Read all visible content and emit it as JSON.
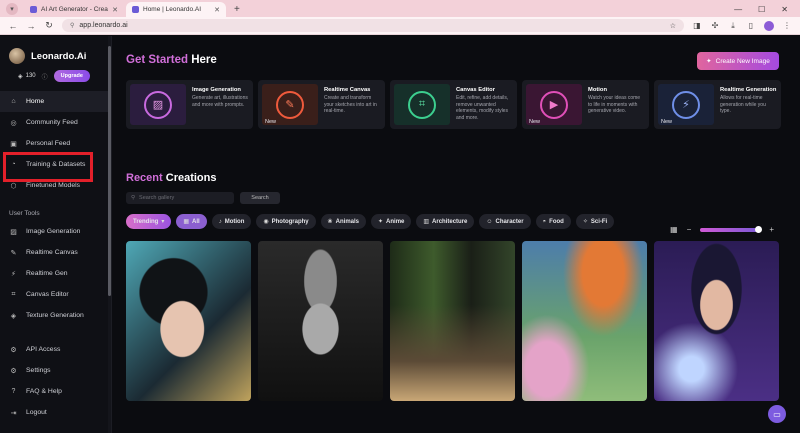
{
  "browser": {
    "tabs": [
      {
        "title": "AI Art Generator - Create Art",
        "active": false
      },
      {
        "title": "Home | Leonardo.AI",
        "active": true
      }
    ],
    "new_tab": "+",
    "url": "app.leonardo.ai"
  },
  "sidebar": {
    "brand": "Leonardo.Ai",
    "credits": "130",
    "upgrade_label": "Upgrade",
    "nav": [
      {
        "label": "Home",
        "icon": "home-icon",
        "glyph": "⌂",
        "active": true
      },
      {
        "label": "Community Feed",
        "icon": "compass-icon",
        "glyph": "◎"
      },
      {
        "label": "Personal Feed",
        "icon": "feed-icon",
        "glyph": "▣"
      },
      {
        "label": "Training & Datasets",
        "icon": "training-icon",
        "glyph": "◔"
      },
      {
        "label": "Finetuned Models",
        "icon": "cube-icon",
        "glyph": "⬡"
      }
    ],
    "section_tools": "User Tools",
    "tools": [
      {
        "label": "Image Generation",
        "icon": "image-icon",
        "glyph": "▨"
      },
      {
        "label": "Realtime Canvas",
        "icon": "canvas-icon",
        "glyph": "✎"
      },
      {
        "label": "Realtime Gen",
        "icon": "lightning-icon",
        "glyph": "⚡"
      },
      {
        "label": "Canvas Editor",
        "icon": "edit-icon",
        "glyph": "⌗"
      },
      {
        "label": "Texture Generation",
        "icon": "texture-icon",
        "glyph": "◈"
      }
    ],
    "bottom": [
      {
        "label": "API Access",
        "icon": "api-icon",
        "glyph": "⚙"
      },
      {
        "label": "Settings",
        "icon": "gear-icon",
        "glyph": "⚙"
      },
      {
        "label": "FAQ & Help",
        "icon": "help-icon",
        "glyph": "?"
      },
      {
        "label": "Logout",
        "icon": "logout-icon",
        "glyph": "⇥"
      }
    ]
  },
  "main": {
    "get_started_accent": "Get Started",
    "get_started_rest": " Here",
    "create_button": "Create New Image",
    "feature_cards": [
      {
        "name": "Image Generation",
        "desc": "Generate art, illustrations and more with prompts.",
        "new": "",
        "color": "#2b1d3e",
        "glyph": "▨"
      },
      {
        "name": "Realtime Canvas",
        "desc": "Create and transform your sketches into art in real-time.",
        "new": "New",
        "color": "#3a1f1a",
        "glyph": "✎"
      },
      {
        "name": "Canvas Editor",
        "desc": "Edit, refine, add details, remove unwanted elements, modify styles and more.",
        "new": "",
        "color": "#16302a",
        "glyph": "⌗"
      },
      {
        "name": "Motion",
        "desc": "Watch your ideas come to life in moments with generative video.",
        "new": "New",
        "color": "#3a1633",
        "glyph": "▶"
      },
      {
        "name": "Realtime Generation",
        "desc": "Allows for real-time generation while you type.",
        "new": "New",
        "color": "#1a2238",
        "glyph": "⚡"
      }
    ],
    "recent_accent": "Recent",
    "recent_rest": " Creations",
    "search_placeholder": "Search gallery",
    "search_button": "Search",
    "filters": [
      {
        "label": "Trending",
        "icon": "flame-icon",
        "glyph": "▾",
        "kind": "trending"
      },
      {
        "label": "All",
        "icon": "grid-icon",
        "glyph": "▦",
        "kind": "all"
      },
      {
        "label": "Motion",
        "icon": "motion-icon",
        "glyph": "♪",
        "kind": ""
      },
      {
        "label": "Photography",
        "icon": "camera-icon",
        "glyph": "◉",
        "kind": ""
      },
      {
        "label": "Animals",
        "icon": "paw-icon",
        "glyph": "❀",
        "kind": ""
      },
      {
        "label": "Anime",
        "icon": "star-icon",
        "glyph": "✦",
        "kind": ""
      },
      {
        "label": "Architecture",
        "icon": "building-icon",
        "glyph": "▥",
        "kind": ""
      },
      {
        "label": "Character",
        "icon": "person-icon",
        "glyph": "☺",
        "kind": ""
      },
      {
        "label": "Food",
        "icon": "food-icon",
        "glyph": "◓",
        "kind": ""
      },
      {
        "label": "Sci-Fi",
        "icon": "rocket-icon",
        "glyph": "✧",
        "kind": ""
      }
    ]
  }
}
